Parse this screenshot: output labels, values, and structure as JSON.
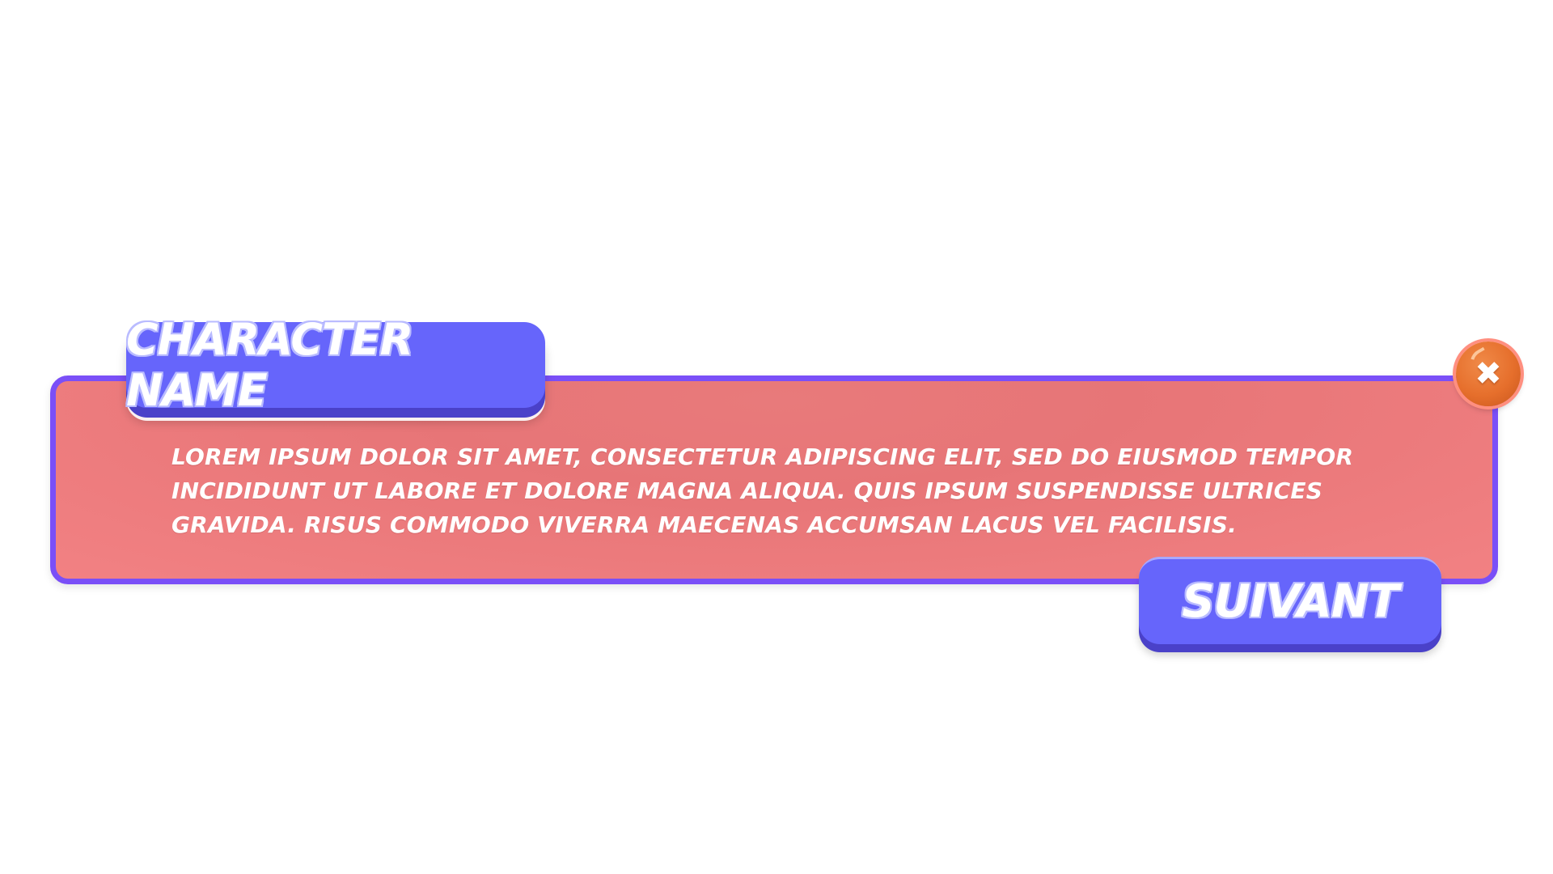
{
  "dialog": {
    "character_name": "CHARACTER NAME",
    "text": "LOREM IPSUM DOLOR SIT AMET, CONSECTETUR ADIPISCING ELIT, SED DO EIUSMOD TEMPOR INCIDIDUNT UT LABORE ET DOLORE MAGNA ALIQUA. QUIS IPSUM SUSPENDISSE ULTRICES GRAVIDA. RISUS COMMODO VIVERRA MAECENAS ACCUMSAN LACUS VEL FACILISIS.",
    "next_label": "SUIVANT",
    "close_icon": "close-icon"
  },
  "colors": {
    "panel_fill": "#e77577",
    "panel_border": "#7a4ff7",
    "button_fill": "#6665fb",
    "button_shadow": "#4a41c9",
    "close_fill": "#e66f2c"
  }
}
